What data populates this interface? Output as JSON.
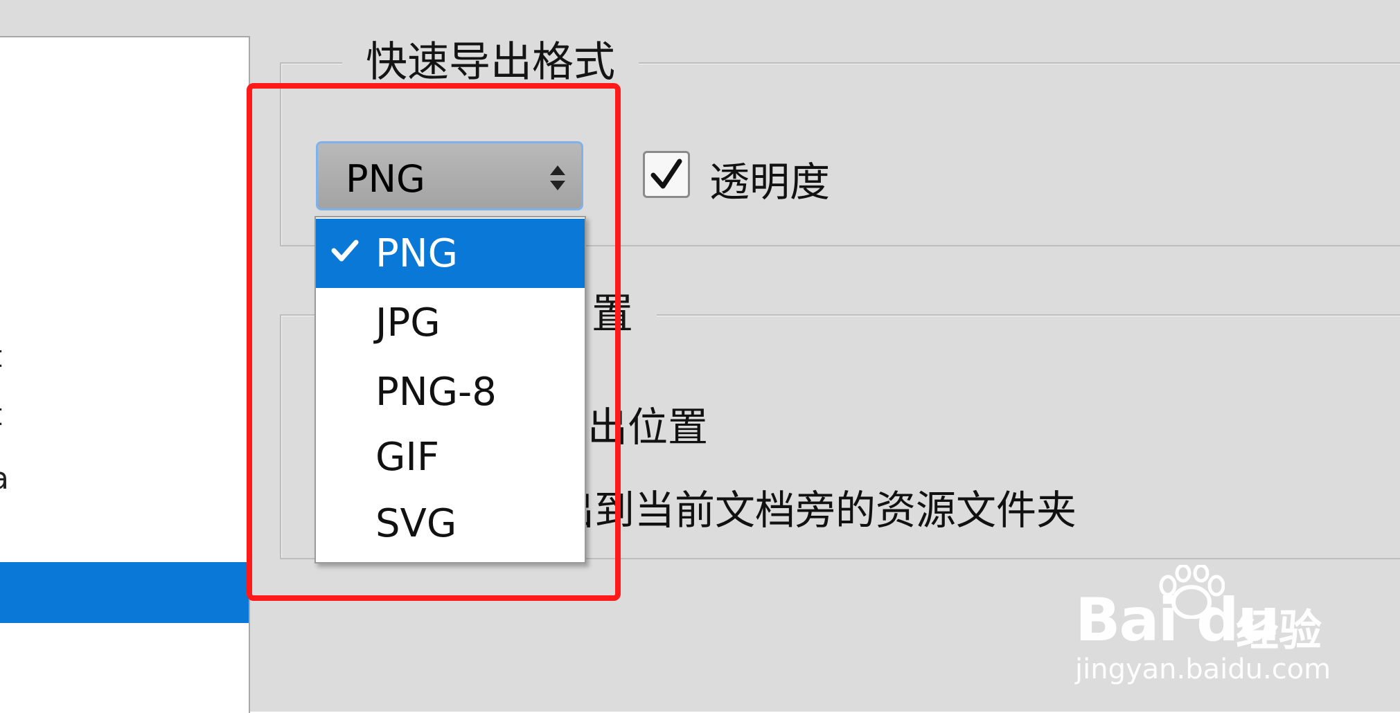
{
  "export_format_group": {
    "title": "快速导出格式",
    "format_select": {
      "selected": "PNG"
    },
    "transparency": {
      "label": "透明度",
      "checked": true
    }
  },
  "location_group": {
    "title_partial": "置",
    "line1_partial": "导出位置",
    "line2_partial": "出到当前文档旁的资源文件夹"
  },
  "dropdown": {
    "options": [
      "PNG",
      "JPG",
      "PNG-8",
      "GIF",
      "SVG"
    ],
    "selected_index": 0
  },
  "left_panel": {
    "partial_glyphs": [
      "t",
      "t",
      "a"
    ]
  },
  "watermark": {
    "brand": "Bai du",
    "brand_cn": "经验",
    "url": "jingyan.baidu.com"
  },
  "colors": {
    "highlight": "#0a78d7",
    "annotation_red": "#ff1a1a",
    "background": "#dcdcdc"
  }
}
